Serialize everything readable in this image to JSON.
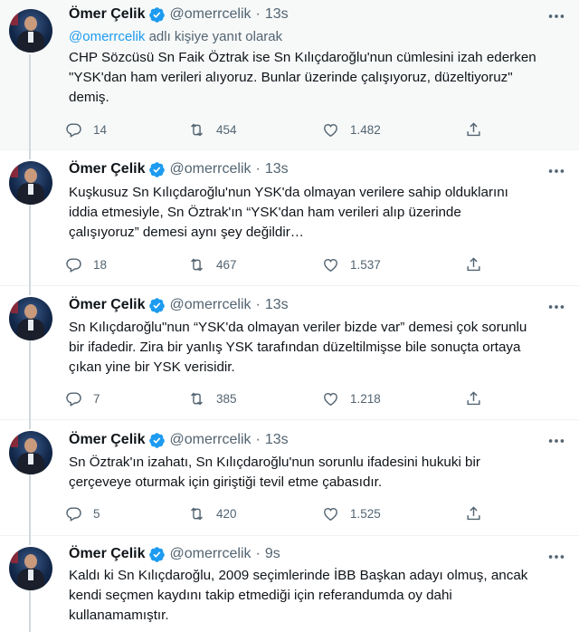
{
  "author": {
    "name": "Ömer Çelik",
    "handle": "@omerrcelik"
  },
  "tweets": [
    {
      "time": "13s",
      "reply_prefix": "@omerrcelik",
      "reply_suffix": " adlı kişiye yanıt olarak",
      "text": "CHP Sözcüsü Sn Faik Öztrak ise Sn Kılıçdaroğlu'nun cümlesini izah ederken\n\"YSK'dan ham verileri alıyoruz. Bunlar üzerinde çalışıyoruz, düzeltiyoruz\"\ndemiş.",
      "replies": "14",
      "retweets": "454",
      "likes": "1.482"
    },
    {
      "time": "13s",
      "text": "Kuşkusuz Sn Kılıçdaroğlu'nun YSK'da olmayan verilere sahip olduklarını\niddia etmesiyle, Sn Öztrak'ın “YSK'dan ham verileri alıp üzerinde\nçalışıyoruz” demesi aynı şey değildir…",
      "replies": "18",
      "retweets": "467",
      "likes": "1.537"
    },
    {
      "time": "13s",
      "text": "Sn Kılıçdaroğlu\"nun “YSK'da olmayan veriler bizde var” demesi çok sorunlu\nbir ifadedir. Zira bir yanlış YSK tarafından düzeltilmişse bile sonuçta ortaya\nçıkan yine bir YSK verisidir.",
      "replies": "7",
      "retweets": "385",
      "likes": "1.218"
    },
    {
      "time": "13s",
      "text": "Sn Öztrak'ın izahatı, Sn Kılıçdaroğlu'nun sorunlu ifadesini hukuki bir\nçerçeveye oturmak için giriştiği tevil etme çabasıdır.",
      "replies": "5",
      "retweets": "420",
      "likes": "1.525"
    },
    {
      "time": "9s",
      "text": "Kaldı ki Sn Kılıçdaroğlu, 2009 seçimlerinde İBB Başkan adayı olmuş, ancak\nkendi seçmen kaydını takip etmediği için referandumda oy dahi\nkullanamamıştır."
    }
  ],
  "colors": {
    "verified": "#1d9bf0",
    "mention": "#1d9bf0",
    "secondary_text": "#536471",
    "thread_line": "#cfd9de"
  }
}
